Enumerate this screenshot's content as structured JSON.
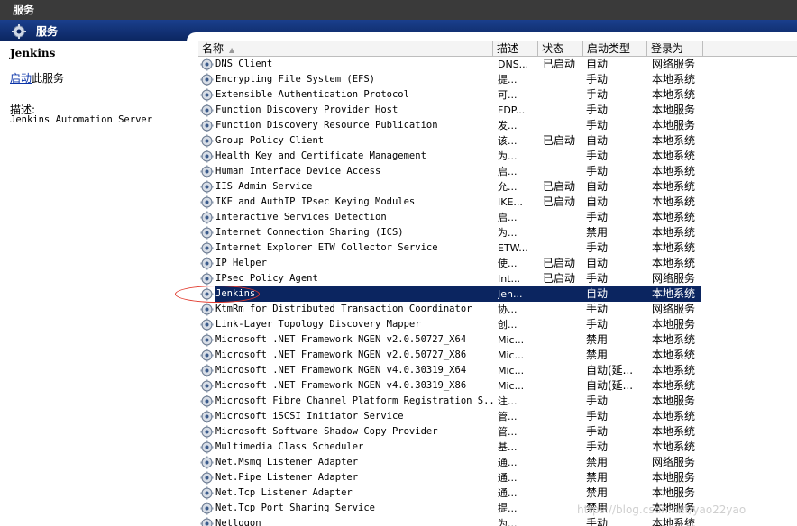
{
  "window": {
    "title": "服务"
  },
  "panel": {
    "title": "服务"
  },
  "details": {
    "service_name": "Jenkins",
    "start_link": "启动",
    "start_suffix": "此服务",
    "desc_label": "描述:",
    "desc_text": "Jenkins Automation Server"
  },
  "table": {
    "columns": [
      "名称",
      "描述",
      "状态",
      "启动类型",
      "登录为"
    ],
    "rows": [
      {
        "name": "DNS Client",
        "desc": "DNS...",
        "status": "已启动",
        "start": "自动",
        "logon": "网络服务"
      },
      {
        "name": "Encrypting File System (EFS)",
        "desc": "提...",
        "status": "",
        "start": "手动",
        "logon": "本地系统"
      },
      {
        "name": "Extensible Authentication Protocol",
        "desc": "可...",
        "status": "",
        "start": "手动",
        "logon": "本地系统"
      },
      {
        "name": "Function Discovery Provider Host",
        "desc": "FDP...",
        "status": "",
        "start": "手动",
        "logon": "本地服务"
      },
      {
        "name": "Function Discovery Resource Publication",
        "desc": "发...",
        "status": "",
        "start": "手动",
        "logon": "本地服务"
      },
      {
        "name": "Group Policy Client",
        "desc": "该...",
        "status": "已启动",
        "start": "自动",
        "logon": "本地系统"
      },
      {
        "name": "Health Key and Certificate Management",
        "desc": "为...",
        "status": "",
        "start": "手动",
        "logon": "本地系统"
      },
      {
        "name": "Human Interface Device Access",
        "desc": "启...",
        "status": "",
        "start": "手动",
        "logon": "本地系统"
      },
      {
        "name": "IIS Admin Service",
        "desc": "允...",
        "status": "已启动",
        "start": "自动",
        "logon": "本地系统"
      },
      {
        "name": "IKE and AuthIP IPsec Keying Modules",
        "desc": "IKE...",
        "status": "已启动",
        "start": "自动",
        "logon": "本地系统"
      },
      {
        "name": "Interactive Services Detection",
        "desc": "启...",
        "status": "",
        "start": "手动",
        "logon": "本地系统"
      },
      {
        "name": "Internet Connection Sharing (ICS)",
        "desc": "为...",
        "status": "",
        "start": "禁用",
        "logon": "本地系统"
      },
      {
        "name": "Internet Explorer ETW Collector Service",
        "desc": "ETW...",
        "status": "",
        "start": "手动",
        "logon": "本地系统"
      },
      {
        "name": "IP Helper",
        "desc": "使...",
        "status": "已启动",
        "start": "自动",
        "logon": "本地系统"
      },
      {
        "name": "IPsec Policy Agent",
        "desc": "Int...",
        "status": "已启动",
        "start": "手动",
        "logon": "网络服务"
      },
      {
        "name": "Jenkins",
        "desc": "Jen...",
        "status": "",
        "start": "自动",
        "logon": "本地系统",
        "selected": true
      },
      {
        "name": "KtmRm for Distributed Transaction Coordinator",
        "desc": "协...",
        "status": "",
        "start": "手动",
        "logon": "网络服务"
      },
      {
        "name": "Link-Layer Topology Discovery Mapper",
        "desc": "创...",
        "status": "",
        "start": "手动",
        "logon": "本地服务"
      },
      {
        "name": "Microsoft .NET Framework NGEN v2.0.50727_X64",
        "desc": "Mic...",
        "status": "",
        "start": "禁用",
        "logon": "本地系统"
      },
      {
        "name": "Microsoft .NET Framework NGEN v2.0.50727_X86",
        "desc": "Mic...",
        "status": "",
        "start": "禁用",
        "logon": "本地系统"
      },
      {
        "name": "Microsoft .NET Framework NGEN v4.0.30319_X64",
        "desc": "Mic...",
        "status": "",
        "start": "自动(延...",
        "logon": "本地系统"
      },
      {
        "name": "Microsoft .NET Framework NGEN v4.0.30319_X86",
        "desc": "Mic...",
        "status": "",
        "start": "自动(延...",
        "logon": "本地系统"
      },
      {
        "name": "Microsoft Fibre Channel Platform Registration S...",
        "desc": "注...",
        "status": "",
        "start": "手动",
        "logon": "本地服务"
      },
      {
        "name": "Microsoft iSCSI Initiator Service",
        "desc": "管...",
        "status": "",
        "start": "手动",
        "logon": "本地系统"
      },
      {
        "name": "Microsoft Software Shadow Copy Provider",
        "desc": "管...",
        "status": "",
        "start": "手动",
        "logon": "本地系统"
      },
      {
        "name": "Multimedia Class Scheduler",
        "desc": "基...",
        "status": "",
        "start": "手动",
        "logon": "本地系统"
      },
      {
        "name": "Net.Msmq Listener Adapter",
        "desc": "通...",
        "status": "",
        "start": "禁用",
        "logon": "网络服务"
      },
      {
        "name": "Net.Pipe Listener Adapter",
        "desc": "通...",
        "status": "",
        "start": "禁用",
        "logon": "本地服务"
      },
      {
        "name": "Net.Tcp Listener Adapter",
        "desc": "通...",
        "status": "",
        "start": "禁用",
        "logon": "本地服务"
      },
      {
        "name": "Net.Tcp Port Sharing Service",
        "desc": "提...",
        "status": "",
        "start": "禁用",
        "logon": "本地服务"
      },
      {
        "name": "Netlogon",
        "desc": "为...",
        "status": "",
        "start": "手动",
        "logon": "本地系统"
      }
    ]
  },
  "watermark": "https://blog.csdn.net/yao22yao",
  "colors": {
    "selection": "#0b2560",
    "annotation": "#e23b2e",
    "link": "#0a33a8"
  }
}
